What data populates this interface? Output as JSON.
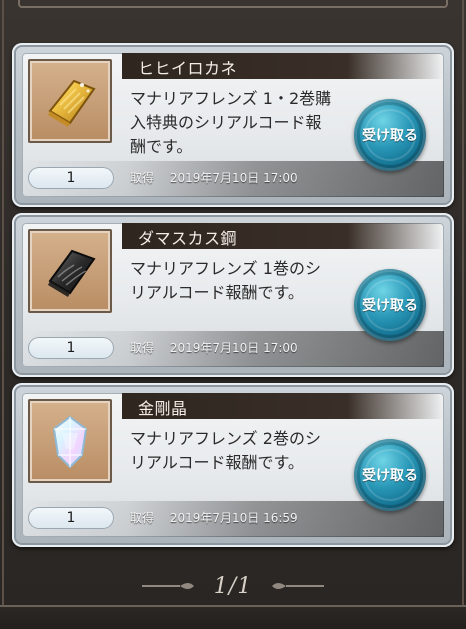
{
  "items": [
    {
      "title": "ヒヒイロカネ",
      "description": "マナリアフレンズ 1・2巻購\n入特典のシリアルコード報\n酬です。",
      "quantity": "1",
      "date_label": "取得",
      "date_value": "2019年7月10日 17:00",
      "button_label": "受け取る",
      "icon": "gold-bar-icon"
    },
    {
      "title": "ダマスカス鋼",
      "description": "マナリアフレンズ 1巻のシ\nリアルコード報酬です。",
      "quantity": "1",
      "date_label": "取得",
      "date_value": "2019年7月10日 17:00",
      "button_label": "受け取る",
      "icon": "damascus-steel-icon"
    },
    {
      "title": "金剛晶",
      "description": "マナリアフレンズ 2巻のシ\nリアルコード報酬です。",
      "quantity": "1",
      "date_label": "取得",
      "date_value": "2019年7月10日 16:59",
      "button_label": "受け取る",
      "icon": "crystal-icon"
    }
  ],
  "pager": {
    "text": "1/1"
  },
  "colors": {
    "button": "#2a98b8",
    "title_bar": "#2f2620",
    "card_frame": "#b7c0c7"
  }
}
